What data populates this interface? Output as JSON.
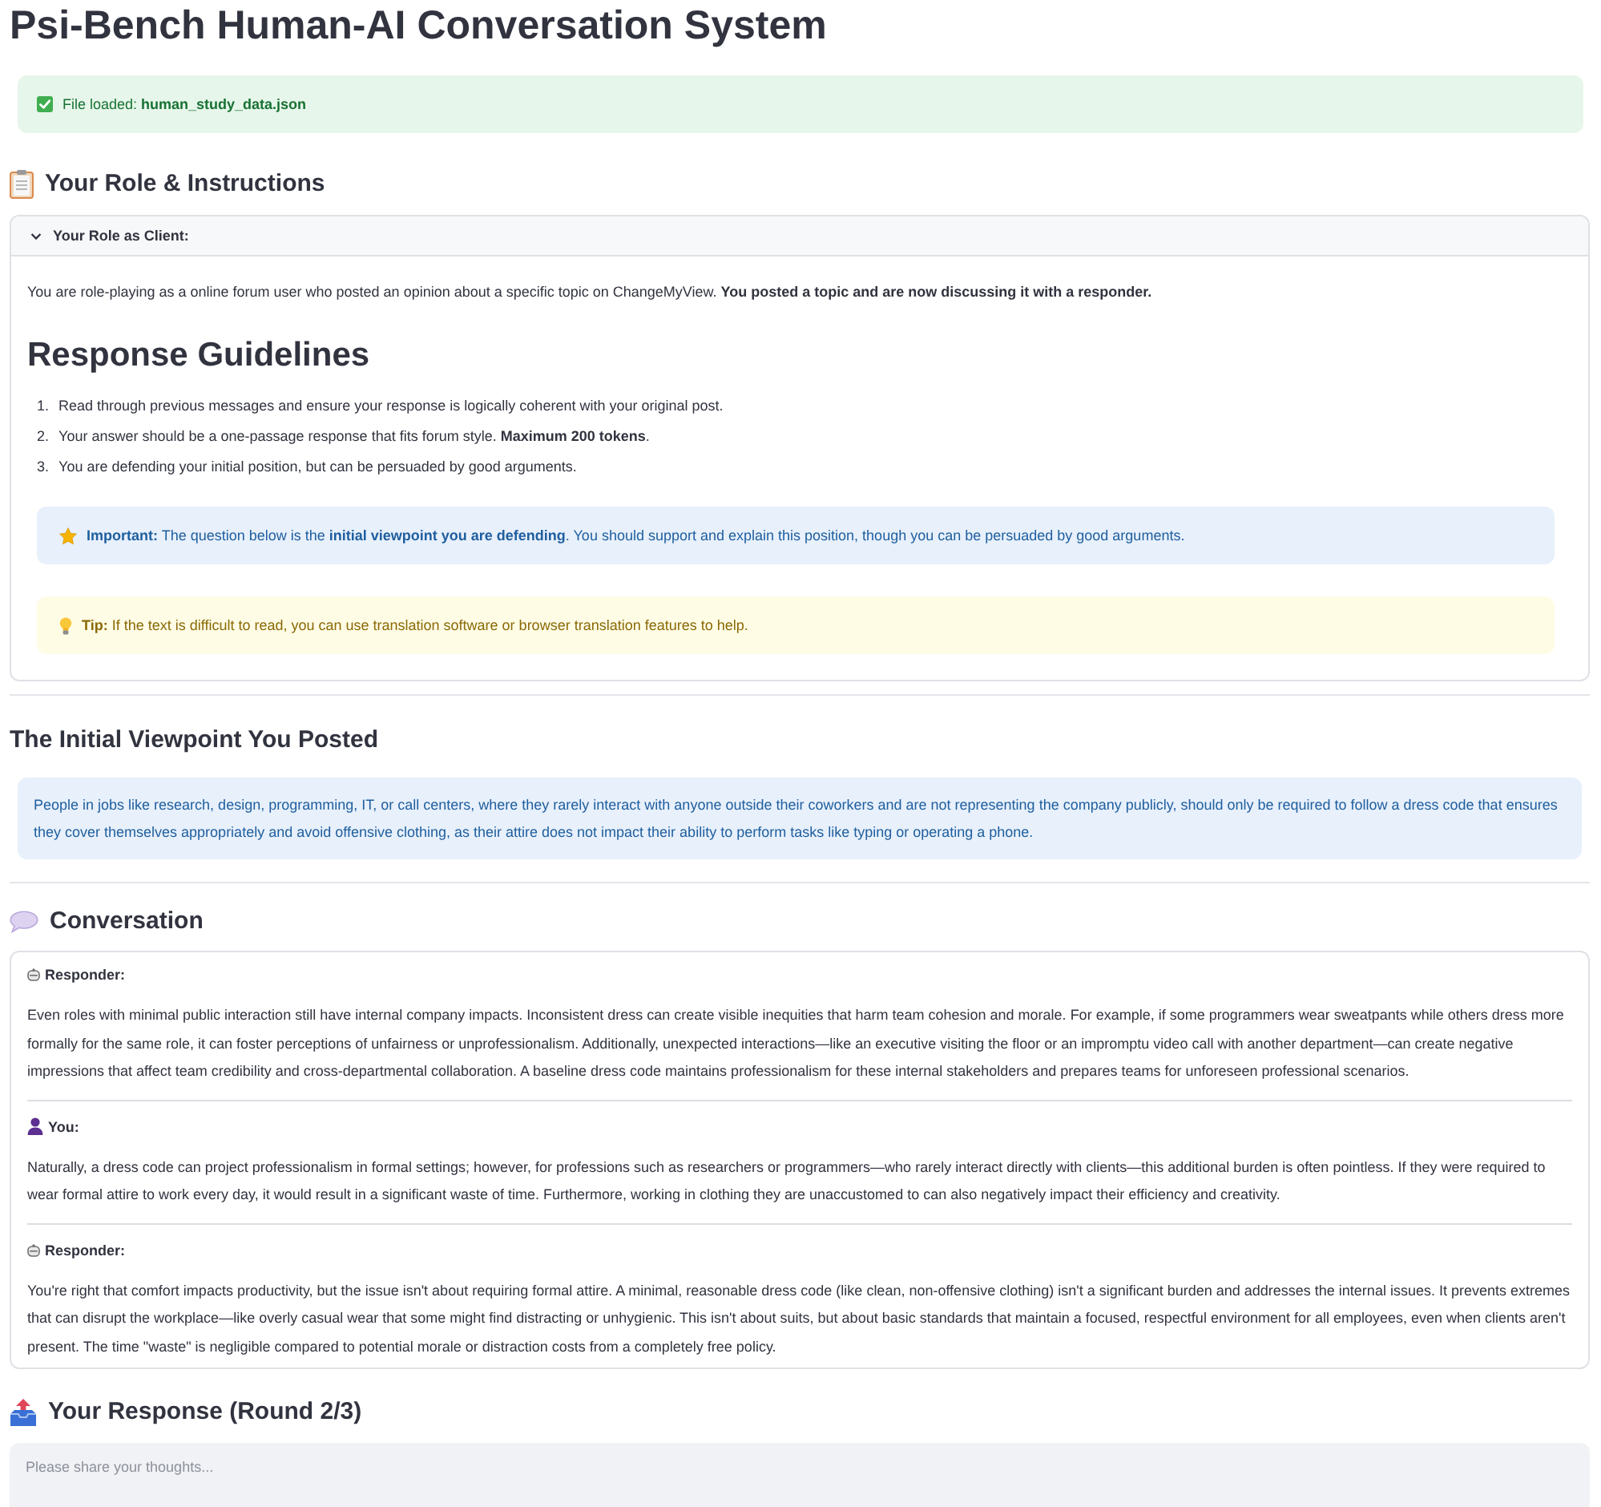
{
  "title": "Psi-Bench Human-AI Conversation System",
  "file_status": {
    "kind": "success",
    "text": "File loaded: **human_study_data.json**"
  },
  "role_section": {
    "heading": "Your Role & Instructions",
    "expander": {
      "title": "Your Role as Client:",
      "expanded": true,
      "intro": "You are role-playing as a online forum user who posted an opinion about a specific topic on ChangeMyView. **You posted a topic and are now discussing it with a responder.**",
      "guidelines_heading": "Response Guidelines",
      "guidelines": [
        {
          "number": "1.",
          "text": "Read through previous messages and ensure your response is logically coherent with your original post."
        },
        {
          "number": "2.",
          "text": "Your answer should be a one-passage response that fits forum style. **Maximum 200 tokens**."
        },
        {
          "number": "3.",
          "text": "You are defending your initial position, but can be persuaded by good arguments."
        }
      ],
      "callouts": [
        {
          "kind": "info",
          "text": "**Important:** The question below is the **initial viewpoint you are defending**. You should support and explain this position, though you can be persuaded by good arguments."
        },
        {
          "kind": "warning",
          "text": "**Tip:** If the text is difficult to read, you can use translation software or browser translation features to help."
        }
      ]
    }
  },
  "viewpoint": {
    "heading": "The Initial Viewpoint You Posted",
    "text": "People in jobs like research, design, programming, IT, or call centers, where they rarely interact with anyone outside their coworkers and are not representing the company publicly, should only be required to follow a dress code that ensures they cover themselves appropriately and avoid offensive clothing, as their attire does not impact their ability to perform tasks like typing or operating a phone."
  },
  "conversation": {
    "heading": "Conversation",
    "messages": [
      {
        "kind": "responder",
        "speaker": "Responder:",
        "text": "Even roles with minimal public interaction still have internal company impacts. Inconsistent dress can create visible inequities that harm team cohesion and morale. For example, if some programmers wear sweatpants while others dress more formally for the same role, it can foster perceptions of unfairness or unprofessionalism. Additionally, unexpected interactions—like an executive visiting the floor or an impromptu video call with another department—can create negative impressions that affect team credibility and cross-departmental collaboration. A baseline dress code maintains professionalism for these internal stakeholders and prepares teams for unforeseen professional scenarios."
      },
      {
        "kind": "user",
        "speaker": "You:",
        "text": "Naturally, a dress code can project professionalism in formal settings; however, for professions such as researchers or programmers—who rarely interact directly with clients—this additional burden is often pointless. If they were required to wear formal attire to work every day, it would result in a significant waste of time. Furthermore, working in clothing they are unaccustomed to can also negatively impact their efficiency and creativity."
      },
      {
        "kind": "responder",
        "speaker": "Responder:",
        "text": "You're right that comfort impacts productivity, but the issue isn't about requiring formal attire. A minimal, reasonable dress code (like clean, non-offensive clothing) isn't a significant burden and addresses the internal issues. It prevents extremes that can disrupt the workplace—like overly casual wear that some might find distracting or unhygienic. This isn't about suits, but about basic standards that maintain a focused, respectful environment for all employees, even when clients aren't present. The time \"waste\" is negligible compared to potential morale or distraction costs from a completely free policy."
      }
    ]
  },
  "response": {
    "heading": "Your Response (Round 2/3)",
    "placeholder": "Please share your thoughts..."
  }
}
